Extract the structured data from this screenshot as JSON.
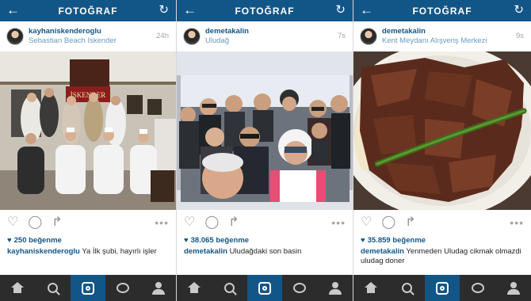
{
  "header": {
    "title": "FOTOĞRAF",
    "back_icon": "back-arrow-icon",
    "refresh_icon": "refresh-icon"
  },
  "posts": [
    {
      "username": "kayhaniskenderoglu",
      "location": "Sebastian Beach Iskender",
      "time": "24h",
      "sign_text": "İSKENDER",
      "likes": "250 beğenme",
      "caption_user": "kayhaniskenderoglu",
      "caption_text": "Ya İlk şubi, hayırlı işler"
    },
    {
      "username": "demetakalin",
      "location": "Uludağ",
      "time": "7s",
      "likes": "38.065 beğenme",
      "caption_user": "demetakalin",
      "caption_text": "Uludağdaki son basin"
    },
    {
      "username": "demetakalin",
      "location": "Kent Meydanı Alışveriş Merkezi",
      "time": "9s",
      "likes": "35.859 beğenme",
      "caption_user": "demetakalin",
      "caption_text": "Yenmeden Uludag cikmak olmazdi uludag doner"
    }
  ],
  "actions": {
    "like_icon": "heart-icon",
    "comment_icon": "comment-icon",
    "share_icon": "share-icon",
    "more_icon": "more-icon"
  },
  "nav": [
    "home-icon",
    "search-icon",
    "camera-icon",
    "activity-icon",
    "profile-icon"
  ],
  "colors": {
    "brand": "#125688",
    "nav_bg": "#2c2c2c"
  }
}
